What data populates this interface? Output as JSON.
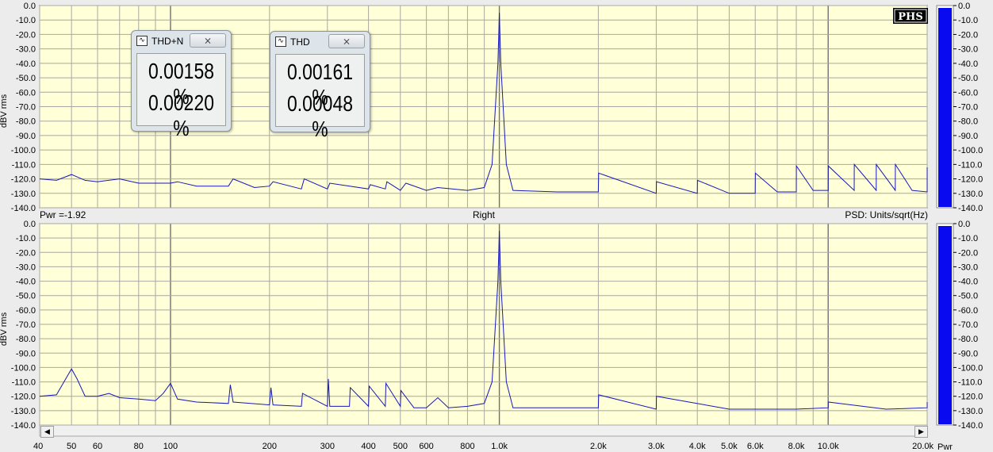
{
  "chart_data": [
    {
      "type": "line",
      "title": "",
      "ylabel": "dBV rms",
      "ylim": [
        -140,
        0
      ],
      "yticks": [
        "0.0",
        "-10.0",
        "-20.0",
        "-30.0",
        "-40.0",
        "-50.0",
        "-60.0",
        "-70.0",
        "-80.0",
        "-90.0",
        "-100.0",
        "-110.0",
        "-120.0",
        "-130.0",
        "-140.0"
      ],
      "x_scale": "log",
      "xlim": [
        40,
        20000
      ],
      "series": [
        {
          "values": [
            [
              40,
              -120
            ],
            [
              45,
              -121
            ],
            [
              50,
              -117
            ],
            [
              55,
              -121
            ],
            [
              60,
              -122
            ],
            [
              70,
              -120
            ],
            [
              80,
              -123
            ],
            [
              100,
              -123
            ],
            [
              105,
              -122
            ],
            [
              120,
              -125
            ],
            [
              150,
              -125
            ],
            [
              155,
              -120
            ],
            [
              180,
              -126
            ],
            [
              200,
              -125
            ],
            [
              205,
              -122
            ],
            [
              250,
              -127
            ],
            [
              255,
              -120
            ],
            [
              300,
              -127
            ],
            [
              305,
              -123
            ],
            [
              400,
              -127
            ],
            [
              405,
              -124
            ],
            [
              450,
              -127
            ],
            [
              455,
              -122
            ],
            [
              500,
              -128
            ],
            [
              520,
              -123
            ],
            [
              600,
              -128
            ],
            [
              650,
              -126
            ],
            [
              800,
              -128
            ],
            [
              900,
              -126
            ],
            [
              950,
              -110
            ],
            [
              990,
              -40
            ],
            [
              1000,
              -5
            ],
            [
              1010,
              -40
            ],
            [
              1050,
              -110
            ],
            [
              1100,
              -128
            ],
            [
              1500,
              -129
            ],
            [
              2000,
              -129
            ],
            [
              2005,
              -116
            ],
            [
              3000,
              -130
            ],
            [
              3005,
              -122
            ],
            [
              4000,
              -130
            ],
            [
              4005,
              -121
            ],
            [
              5000,
              -130
            ],
            [
              6000,
              -130
            ],
            [
              6005,
              -116
            ],
            [
              7000,
              -129
            ],
            [
              8000,
              -129
            ],
            [
              8005,
              -111
            ],
            [
              9000,
              -128
            ],
            [
              10000,
              -128
            ],
            [
              10005,
              -111
            ],
            [
              12000,
              -128
            ],
            [
              12005,
              -110
            ],
            [
              14000,
              -128
            ],
            [
              14005,
              -110
            ],
            [
              16000,
              -128
            ],
            [
              16005,
              -110
            ],
            [
              18000,
              -128
            ],
            [
              20000,
              -129
            ],
            [
              20005,
              -112
            ]
          ]
        }
      ]
    },
    {
      "type": "line",
      "title": "",
      "ylabel": "dBV rms",
      "ylim": [
        -140,
        0
      ],
      "yticks": [
        "0.0",
        "-10.0",
        "-20.0",
        "-30.0",
        "-40.0",
        "-50.0",
        "-60.0",
        "-70.0",
        "-80.0",
        "-90.0",
        "-100.0",
        "-110.0",
        "-120.0",
        "-130.0",
        "-140.0"
      ],
      "x_scale": "log",
      "xlim": [
        40,
        20000
      ],
      "xticks": [
        "40",
        "50",
        "60",
        "80",
        "100",
        "200",
        "300",
        "400",
        "500",
        "600",
        "800",
        "1.0k",
        "2.0k",
        "3.0k",
        "4.0k",
        "5.0k",
        "6.0k",
        "8.0k",
        "10.0k",
        "20.0k"
      ],
      "series": [
        {
          "values": [
            [
              40,
              -120
            ],
            [
              45,
              -119
            ],
            [
              48,
              -108
            ],
            [
              50,
              -101
            ],
            [
              52,
              -108
            ],
            [
              55,
              -120
            ],
            [
              60,
              -120
            ],
            [
              65,
              -118
            ],
            [
              70,
              -121
            ],
            [
              80,
              -122
            ],
            [
              90,
              -123
            ],
            [
              95,
              -118
            ],
            [
              100,
              -111
            ],
            [
              105,
              -122
            ],
            [
              120,
              -124
            ],
            [
              150,
              -125
            ],
            [
              152,
              -112
            ],
            [
              155,
              -124
            ],
            [
              200,
              -126
            ],
            [
              202,
              -114
            ],
            [
              205,
              -126
            ],
            [
              250,
              -127
            ],
            [
              252,
              -118
            ],
            [
              300,
              -127
            ],
            [
              302,
              -108
            ],
            [
              305,
              -127
            ],
            [
              350,
              -127
            ],
            [
              352,
              -114
            ],
            [
              400,
              -127
            ],
            [
              402,
              -113
            ],
            [
              450,
              -127
            ],
            [
              452,
              -111
            ],
            [
              500,
              -127
            ],
            [
              502,
              -116
            ],
            [
              550,
              -128
            ],
            [
              600,
              -128
            ],
            [
              650,
              -121
            ],
            [
              700,
              -128
            ],
            [
              800,
              -127
            ],
            [
              900,
              -125
            ],
            [
              950,
              -110
            ],
            [
              990,
              -40
            ],
            [
              1000,
              -5
            ],
            [
              1010,
              -40
            ],
            [
              1050,
              -110
            ],
            [
              1100,
              -128
            ],
            [
              1500,
              -128
            ],
            [
              2000,
              -128
            ],
            [
              2005,
              -119
            ],
            [
              3000,
              -129
            ],
            [
              3005,
              -120
            ],
            [
              5000,
              -129
            ],
            [
              6000,
              -129
            ],
            [
              8000,
              -129
            ],
            [
              10000,
              -128
            ],
            [
              10005,
              -124
            ],
            [
              15000,
              -129
            ],
            [
              20000,
              -128
            ],
            [
              20005,
              -124
            ]
          ]
        }
      ]
    }
  ],
  "top_bar": {
    "pwr": "Pwr =-1.92",
    "channel": "Right",
    "psd": "PSD: Units/sqrt(Hz)"
  },
  "logo": "PHS",
  "meter_scale": [
    "0.0",
    "-10.0",
    "-20.0",
    "-30.0",
    "-40.0",
    "-50.0",
    "-60.0",
    "-70.0",
    "-80.0",
    "-90.0",
    "-100.0",
    "-110.0",
    "-120.0",
    "-130.0",
    "-140.0"
  ],
  "meter_level_db": [
    -140,
    -140
  ],
  "meter_pwr_label": "Pwr",
  "meter_color": "#0a0af0",
  "trace_color": "#1818b8",
  "plot_bg": "#ffffd8",
  "thdn_window": {
    "title": "THD+N",
    "close": "⨯",
    "value1": "0.00158 %",
    "value2": "0.00220 %"
  },
  "thd_window": {
    "title": "THD",
    "close": "⨯",
    "value1": "0.00161 %",
    "value2": "0.00048 %"
  }
}
